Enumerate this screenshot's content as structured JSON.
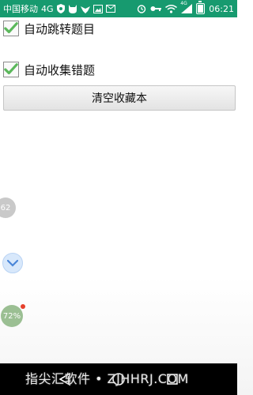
{
  "status_bar": {
    "carrier": "中国移动",
    "network": "4G",
    "network_small": "4G",
    "time": "06:21",
    "icons": [
      "shield-icon",
      "cat-icon",
      "bird-icon",
      "image-icon",
      "mail-icon",
      "alarm-icon",
      "key-icon",
      "wifi-icon",
      "signal-icon",
      "battery-icon"
    ]
  },
  "settings": {
    "auto_jump": {
      "label": "自动跳转题目",
      "checked": true
    },
    "auto_collect": {
      "label": "自动收集错题",
      "checked": true
    }
  },
  "clear_button": {
    "label": "清空收藏本"
  },
  "floating": {
    "badge_1": "62",
    "badge_2": "72%"
  },
  "watermark": "指尖汇软件 • ZJHHRJ.COM",
  "colors": {
    "status_bar": "#179a6f",
    "checkmark": "#5cb85c",
    "nav_bar": "#000000"
  }
}
